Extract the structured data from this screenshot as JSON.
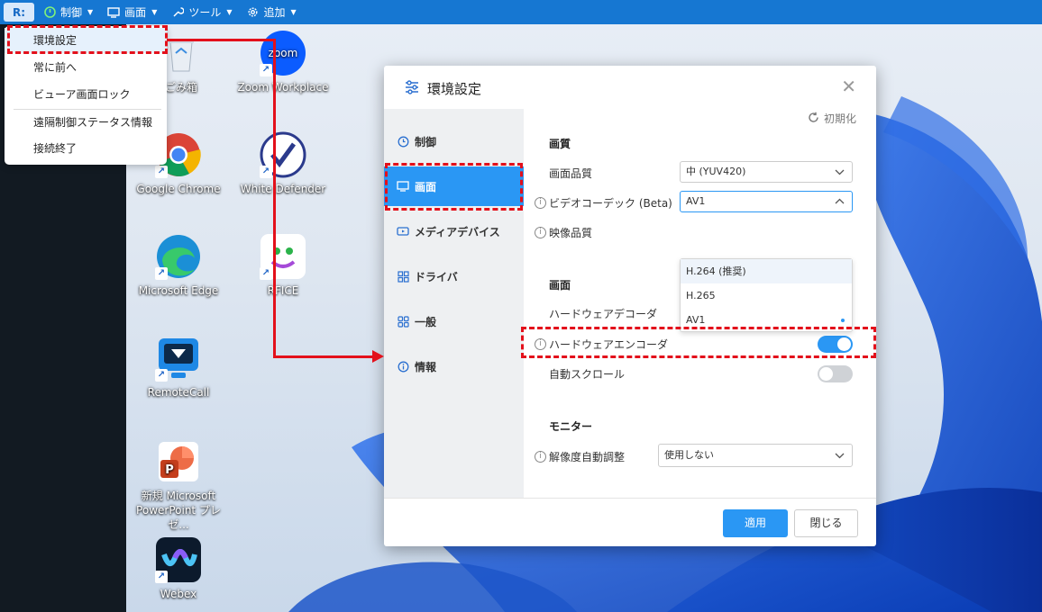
{
  "toolbar": {
    "logo": "R:",
    "items": [
      {
        "label": "制御",
        "icon": "control-icon"
      },
      {
        "label": "画面",
        "icon": "monitor-icon"
      },
      {
        "label": "ツール",
        "icon": "wrench-icon"
      },
      {
        "label": "追加",
        "icon": "gear-icon"
      }
    ]
  },
  "menu": {
    "items": [
      "環境設定",
      "常に前へ",
      "ビューア画面ロック",
      "遠隔制御ステータス情報",
      "接続終了"
    ],
    "selected": "環境設定"
  },
  "desktop_icons": [
    {
      "label": "ごみ箱",
      "icon": "recycle-bin-icon"
    },
    {
      "label": "Zoom Workplace",
      "icon": "zoom-icon"
    },
    {
      "label": "Google Chrome",
      "icon": "chrome-icon"
    },
    {
      "label": "White Defender",
      "icon": "white-defender-icon"
    },
    {
      "label": "Microsoft Edge",
      "icon": "edge-icon"
    },
    {
      "label": "RFICE",
      "icon": "rfice-icon"
    },
    {
      "label": "RemoteCall",
      "icon": "remotecall-icon"
    },
    {
      "label": "新規 Microsoft",
      "label2": "PowerPoint プレゼ...",
      "icon": "powerpoint-icon"
    },
    {
      "label": "Webex",
      "icon": "webex-icon"
    }
  ],
  "dialog": {
    "title": "環境設定",
    "reset_label": "初期化",
    "sidebar": [
      "制御",
      "画面",
      "メディアデバイス",
      "ドライバ",
      "一般",
      "情報"
    ],
    "active_tab": "画面",
    "sections": {
      "quality": "画質",
      "screen": "画面",
      "monitor": "モニター"
    },
    "fields": {
      "image_quality": {
        "label": "画面品質",
        "value": "中 (YUV420)"
      },
      "video_codec": {
        "label": "ビデオコーデック (Beta)",
        "value": "AV1",
        "options": [
          "H.264 (推奨)",
          "H.265",
          "AV1"
        ]
      },
      "video_quality": {
        "label": "映像品質"
      },
      "hw_decoder": {
        "label": "ハードウェアデコーダ",
        "on": true
      },
      "hw_encoder": {
        "label": "ハードウェアエンコーダ",
        "on": true
      },
      "auto_scroll": {
        "label": "自動スクロール",
        "on": false
      },
      "auto_resolution": {
        "label": "解像度自動調整",
        "value": "使用しない"
      }
    },
    "buttons": {
      "apply": "適用",
      "close": "閉じる"
    }
  },
  "colors": {
    "toolbar": "#1677d2",
    "accent": "#2a97f4",
    "highlight": "#e3101b"
  }
}
